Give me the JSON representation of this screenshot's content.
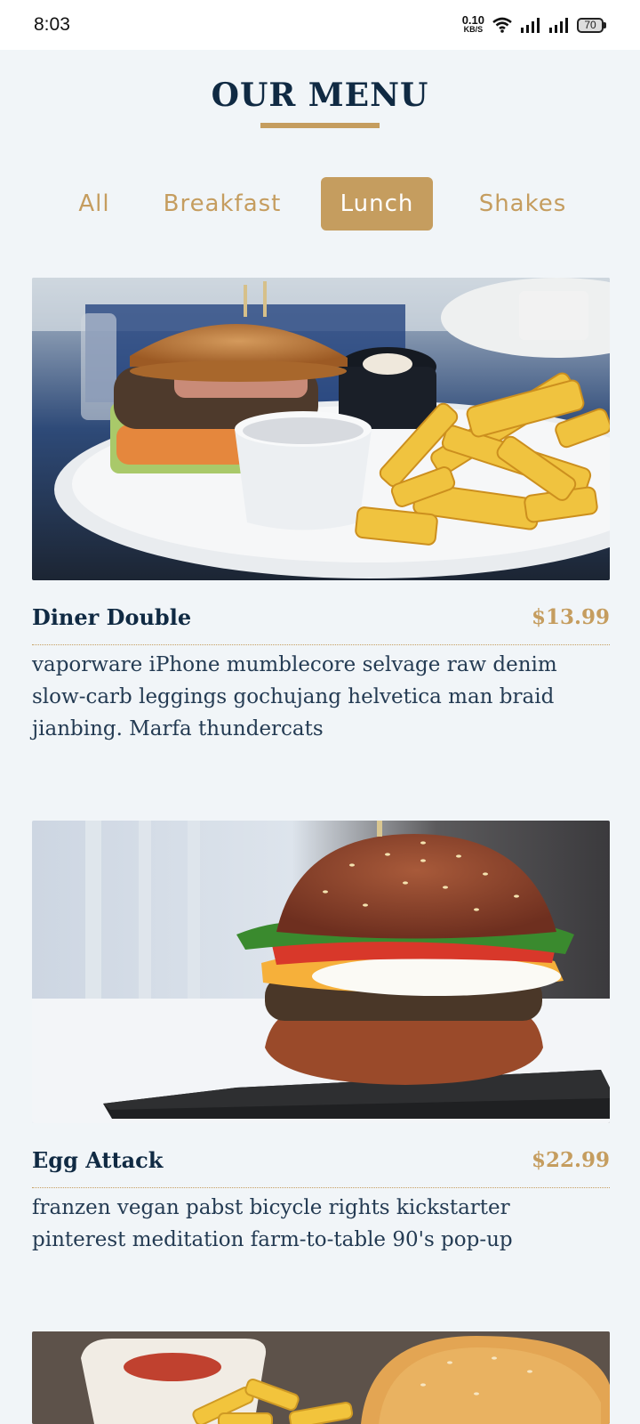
{
  "status_bar": {
    "time": "8:03",
    "net_speed_value": "0.10",
    "net_speed_unit": "KB/S",
    "battery": "70"
  },
  "header": {
    "title": "OUR MENU"
  },
  "tabs": [
    {
      "label": "All",
      "active": false
    },
    {
      "label": "Breakfast",
      "active": false
    },
    {
      "label": "Lunch",
      "active": true
    },
    {
      "label": "Shakes",
      "active": false
    }
  ],
  "menu": [
    {
      "name": "Diner Double",
      "price": "$13.99",
      "desc": "vaporware iPhone mumblecore selvage raw denim slow-carb leggings gochujang helvetica man braid jianbing. Marfa thundercats"
    },
    {
      "name": "Egg Attack",
      "price": "$22.99",
      "desc": "franzen vegan pabst bicycle rights kickstarter pinterest meditation farm-to-table 90's pop-up"
    }
  ],
  "colors": {
    "accent": "#c59d5f",
    "text": "#102a43",
    "background": "#f1f5f8"
  }
}
